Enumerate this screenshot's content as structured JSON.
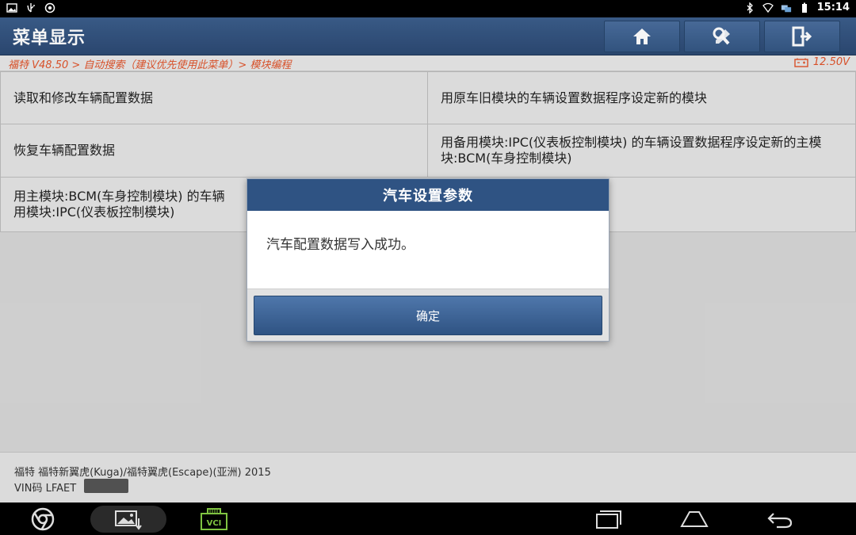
{
  "status_bar": {
    "time": "15:14",
    "icons": [
      "image-icon",
      "usb-icon",
      "settings-gear-icon",
      "bluetooth-icon",
      "wifi-icon",
      "network-icon",
      "battery-icon"
    ]
  },
  "header": {
    "title": "菜单显示",
    "buttons": [
      "home-icon",
      "diagnose-tools-icon",
      "exit-icon"
    ]
  },
  "breadcrumb": {
    "path": "福特 V48.50 > 自动搜索（建议优先使用此菜单）> 模块编程",
    "voltage": "12.50V"
  },
  "menu": {
    "items": [
      "读取和修改车辆配置数据",
      "用原车旧模块的车辆设置数据程序设定新的模块",
      "恢复车辆配置数据",
      "用备用模块:IPC(仪表板控制模块) 的车辆设置数据程序设定新的主模块:BCM(车身控制模块)",
      "用主模块:BCM(车身控制模块) 的车辆设置数据程序设定新的备用模块:IPC(仪表板控制模块)"
    ],
    "item5_visible_line1": "用主模块:BCM(车身控制模块) 的车辆",
    "item5_visible_line2": "用模块:IPC(仪表板控制模块)"
  },
  "vehicle": {
    "line1": "福特 福特新翼虎(Kuga)/福特翼虎(Escape)(亚洲) 2015",
    "vin_label": "VIN码 LFAET"
  },
  "dialog": {
    "title": "汽车设置参数",
    "message": "汽车配置数据写入成功。",
    "ok_label": "确定"
  },
  "nav_bar": {
    "vci_label": "VCI",
    "icons": [
      "browser-icon",
      "screenshot-icon",
      "vci-icon",
      "recent-apps-icon",
      "home-nav-icon",
      "back-icon"
    ]
  },
  "colors": {
    "header": "#2f5383",
    "accent_text": "#e0542b",
    "dialog_header": "#2f5383"
  }
}
